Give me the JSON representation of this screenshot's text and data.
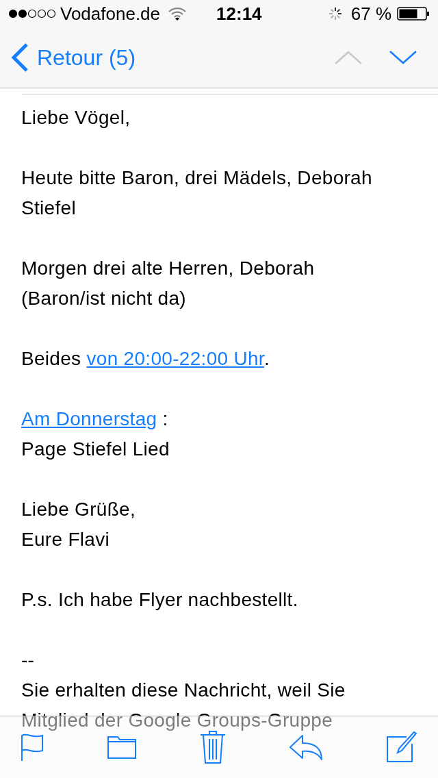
{
  "status_bar": {
    "carrier": "Vodafone.de",
    "time": "12:14",
    "battery": "67 %"
  },
  "nav": {
    "back": "Retour (5)",
    "previous": {
      "disabled": true
    },
    "next": {
      "disabled": false
    }
  },
  "body": [
    {
      "lines": [
        [
          {
            "text": "Liebe Vögel,",
            "link": false
          }
        ]
      ]
    },
    {
      "lines": [
        [
          {
            "text": "Heute bitte Baron, drei Mädels, Deborah Stiefel",
            "link": false
          }
        ]
      ]
    },
    {
      "lines": [
        [
          {
            "text": "Morgen drei alte Herren, Deborah (Baron/ist nicht da)",
            "link": false
          }
        ]
      ]
    },
    {
      "lines": [
        [
          {
            "text": "Beides ",
            "link": false
          },
          {
            "text": "von 20:00-22:00 Uhr",
            "link": true
          },
          {
            "text": ".",
            "link": false
          }
        ]
      ]
    },
    {
      "lines": [
        [
          {
            "text": "Am Donnerstag",
            "link": true
          },
          {
            "text": " :",
            "link": false
          }
        ],
        [
          {
            "text": "Page Stiefel Lied",
            "link": false
          }
        ]
      ]
    },
    {
      "lines": [
        [
          {
            "text": "Liebe Grüße,",
            "link": false
          }
        ],
        [
          {
            "text": "Eure Flavi",
            "link": false
          }
        ]
      ]
    },
    {
      "lines": [
        [
          {
            "text": "P.s. Ich habe Flyer nachbestellt.",
            "link": false
          }
        ]
      ]
    },
    {
      "lines": [
        [
          {
            "text": "--",
            "link": false
          }
        ],
        [
          {
            "text": "Sie erhalten diese Nachricht, weil Sie Mitglied der Google Groups-Gruppe",
            "link": false
          }
        ]
      ]
    }
  ],
  "toolbar": [
    {
      "kind": "flag"
    },
    {
      "kind": "folder"
    },
    {
      "kind": "trash"
    },
    {
      "kind": "reply"
    },
    {
      "kind": "compose"
    }
  ]
}
